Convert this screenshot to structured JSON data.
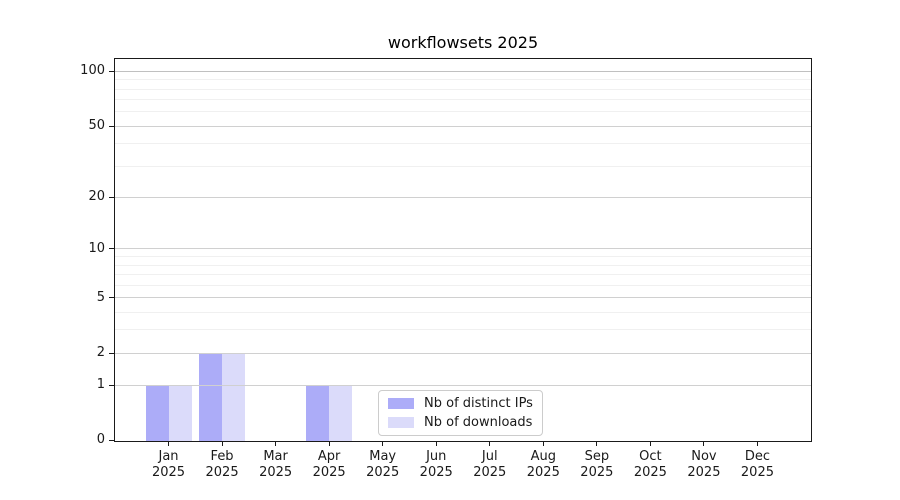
{
  "chart_data": {
    "type": "bar",
    "title": "workflowsets 2025",
    "x_tick_months": [
      "Jan",
      "Feb",
      "Mar",
      "Apr",
      "May",
      "Jun",
      "Jul",
      "Aug",
      "Sep",
      "Oct",
      "Nov",
      "Dec"
    ],
    "x_tick_year": "2025",
    "series": [
      {
        "name": "Nb of distinct IPs",
        "color": "#acacf8",
        "values": [
          1,
          2,
          0,
          1,
          0,
          0,
          0,
          0,
          0,
          0,
          0,
          0
        ]
      },
      {
        "name": "Nb of downloads",
        "color": "#dbdbfa",
        "values": [
          1,
          2,
          0,
          1,
          0,
          0,
          0,
          0,
          0,
          0,
          0,
          0
        ]
      }
    ],
    "y_scale": "log1p",
    "y_major_ticks": [
      0,
      1,
      2,
      5,
      10,
      20,
      50,
      100
    ],
    "y_minor_gridlines": [
      3,
      4,
      6,
      7,
      8,
      9,
      30,
      40,
      60,
      70,
      80,
      90
    ],
    "ylim": [
      0,
      117
    ],
    "grid": "horizontal",
    "legend_position": "inside lower center",
    "colors": {
      "spine": "#1a1a1a",
      "major_grid": "#d0d0d0",
      "minor_grid": "#f0f0f0",
      "top_grid": "#c0c0c0",
      "background": "#ffffff"
    }
  }
}
